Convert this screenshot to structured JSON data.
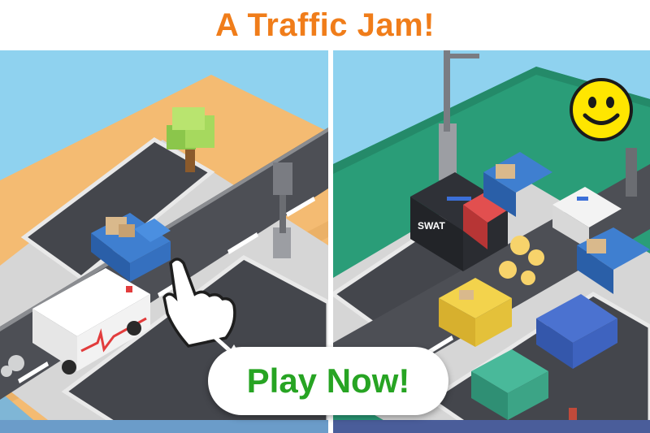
{
  "header": {
    "title": "A Traffic Jam!",
    "title_color": "#f07d1a"
  },
  "cta": {
    "label": "Play Now!",
    "label_color": "#27a423"
  },
  "scene_left": {
    "description_icons": [
      "tap-hand-icon",
      "swipe-arrow-icon"
    ],
    "vehicles": [
      "ambulance",
      "pickup-truck"
    ]
  },
  "scene_right": {
    "van_label": "SWAT",
    "vehicles": [
      "swat-van",
      "police-car",
      "pickup-truck",
      "pickup-truck",
      "taxi",
      "sedan",
      "suv",
      "red-car"
    ],
    "emoji": "smiley-icon"
  },
  "colors": {
    "sky": "#8fd2ef",
    "sand": "#f4bb72",
    "grass_green": "#2a9d78",
    "road": "#4d4f55",
    "lane_line": "#ffffff"
  }
}
